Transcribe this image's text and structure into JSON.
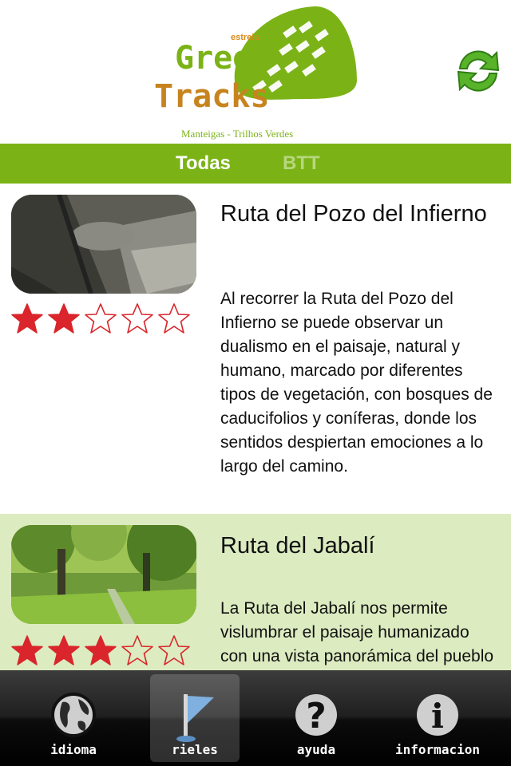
{
  "header": {
    "logo": {
      "small_text": "estrela",
      "line1": "Green",
      "line2": "Tracks",
      "tagline": "Manteigas - Trilhos Verdes"
    },
    "refresh_icon": "refresh-icon"
  },
  "filter_tabs": [
    {
      "label": "Todas",
      "selected": true
    },
    {
      "label": "BTT",
      "selected": false
    }
  ],
  "colors": {
    "brand_green": "#7bb317",
    "star_red": "#d9252b",
    "alt_row": "#dcebc0"
  },
  "routes": [
    {
      "title": "Ruta del Pozo del Infierno",
      "description": "Al recorrer la Ruta del Pozo del Infierno se puede observar un dualismo en el paisaje, natural y humano, marcado por diferentes tipos de vegetación, con bosques de caducifolios y coníferas, donde los sentidos despiertan emociones a lo largo del camino.",
      "rating": 2,
      "rating_max": 5
    },
    {
      "title": "Ruta del Jabalí",
      "description": "La Ruta del Jabalí nos permite vislumbrar el paisaje humanizado con una vista panorámica del pueblo de",
      "rating": 3,
      "rating_max": 5
    }
  ],
  "tabbar": [
    {
      "label": "idioma",
      "icon": "globe-icon",
      "active": false
    },
    {
      "label": "rieles",
      "icon": "flag-icon",
      "active": true
    },
    {
      "label": "ayuda",
      "icon": "question-icon",
      "active": false
    },
    {
      "label": "informacion",
      "icon": "info-icon",
      "active": false
    }
  ]
}
